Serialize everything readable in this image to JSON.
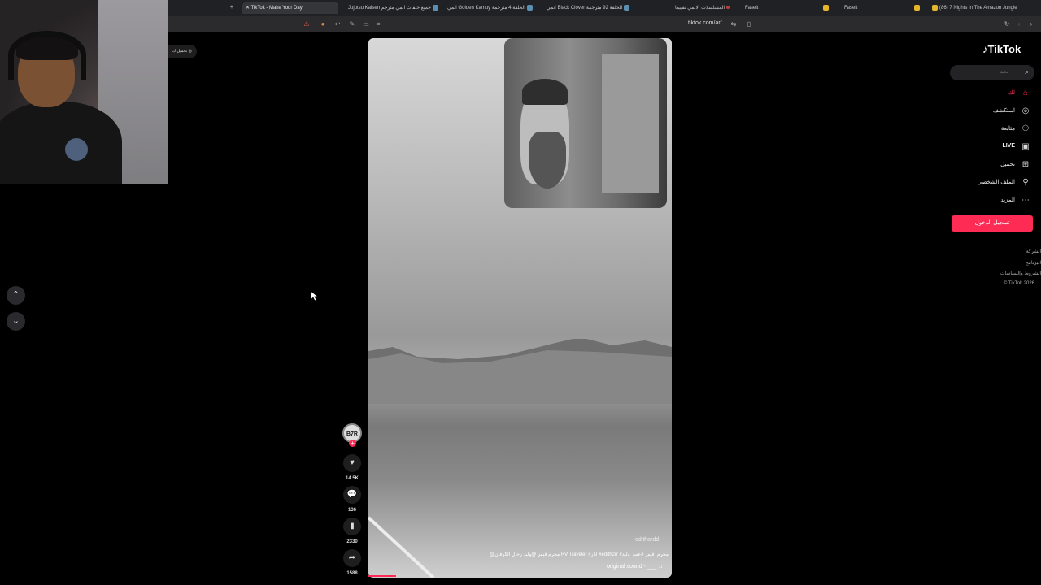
{
  "browser": {
    "tabs": [
      {
        "label": "TikTok - Make Your Day",
        "active": true
      },
      {
        "label": "Jujutsu Kaisen جميع حلقات انمي مترجم",
        "active": false
      },
      {
        "label": "انمي Golden Kamuy الحلقة 4 مترجمة",
        "active": false
      },
      {
        "label": "انمي Black Clover الحلقة 92 مترجمة",
        "active": false
      },
      {
        "label": "المسلسلات الانمي تقييما",
        "active": false
      },
      {
        "label": "Faselt",
        "active": false
      },
      {
        "label": "Faselt",
        "active": false
      },
      {
        "label": "(86) 7 Nights In The Amazon Jungle",
        "active": false
      }
    ],
    "url": "tiktok.com/ar/",
    "accent": "#fe2c55"
  },
  "upload_chip": {
    "label": "تحميل ك"
  },
  "video": {
    "watermark": "edithardd",
    "caption": "@مجرم قيمز @وليد رحال الكرفان RV Traveler #ايار #edith2rr #مجرم_قيمز #عمو_وليد",
    "sound": "original sound - ___",
    "progress": 0.09
  },
  "actions": {
    "avatar_initials": "B7R",
    "likes": "14.5K",
    "comments": "136",
    "saves": "2330",
    "shares": "1588"
  },
  "sidebar": {
    "logo": "TikTok",
    "search_placeholder": "بحث",
    "items": [
      {
        "label": "لك",
        "icon": "home-icon"
      },
      {
        "label": "استكشف",
        "icon": "compass-icon"
      },
      {
        "label": "متابعة",
        "icon": "following-icon"
      },
      {
        "label": "LIVE",
        "icon": "live-icon"
      },
      {
        "label": "تحميل",
        "icon": "upload-icon"
      },
      {
        "label": "الملف الشخصي",
        "icon": "profile-icon"
      },
      {
        "label": "المزيد",
        "icon": "more-icon"
      }
    ],
    "login_label": "تسجيل الدخول",
    "footer": [
      "الشركة",
      "البرنامج",
      "الشروط والسياسات",
      "© TikTok 2026"
    ]
  }
}
